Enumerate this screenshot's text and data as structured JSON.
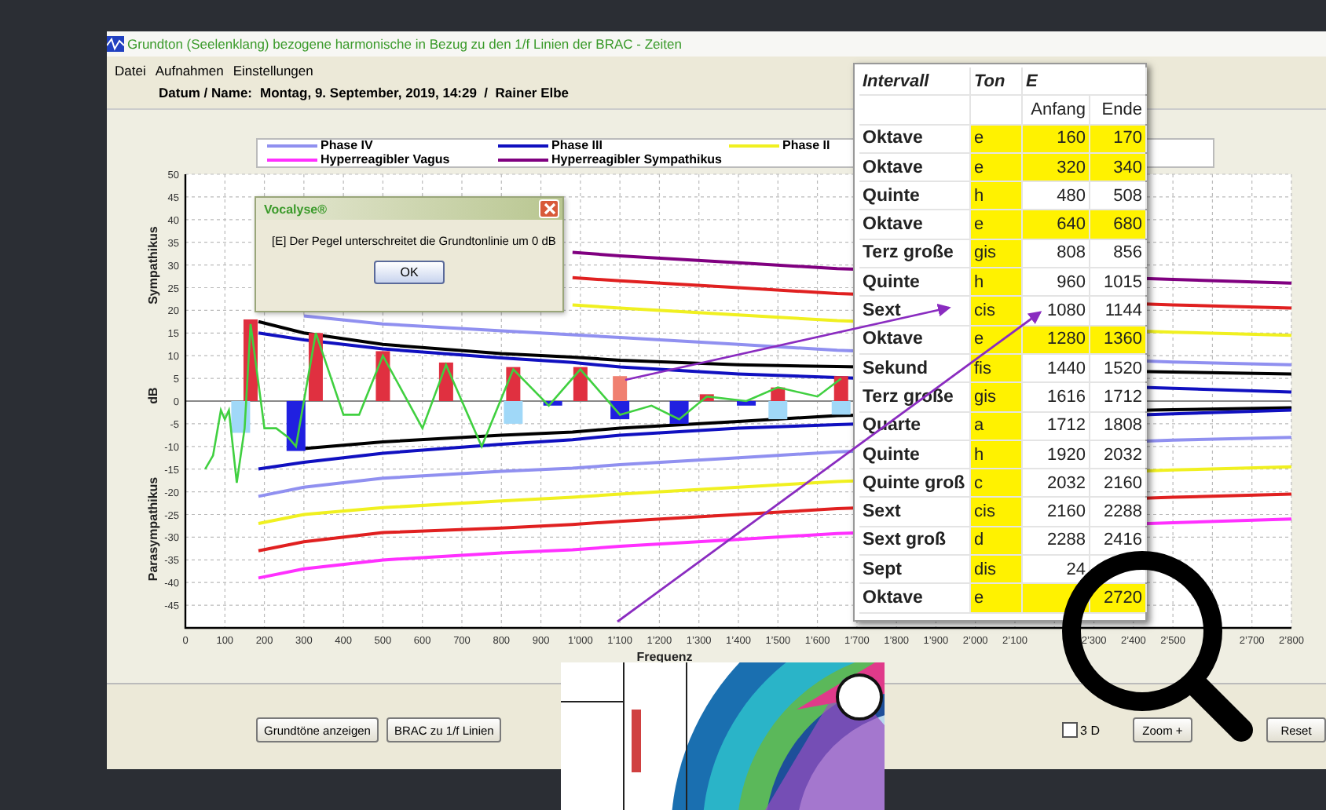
{
  "window": {
    "title": "Grundton (Seelenklang) bezogene harmonische in Bezug zu den 1/f Linien der BRAC - Zeiten"
  },
  "menu": [
    "Datei",
    "Aufnahmen",
    "Einstellungen"
  ],
  "header": {
    "label": "Datum / Name:",
    "value": "Montag, 9. September, 2019, 14:29  /  Rainer Elbe"
  },
  "chart": {
    "legend": [
      {
        "label": "Phase IV",
        "color": "#9090f0"
      },
      {
        "label": "Phase III",
        "color": "#1010c0"
      },
      {
        "label": "Phase II",
        "color": "#f0f020"
      },
      {
        "label": "Hyperreagibler Vagus",
        "color": "#ff30ff"
      },
      {
        "label": "Hyperreagibler Sympathikus",
        "color": "#800080"
      }
    ],
    "axis_labels": {
      "upper": "Sympathikus",
      "lower": "Parasympathikus"
    },
    "chart_data": {
      "type": "line",
      "xlabel": "Frequenz",
      "ylabel": "dB",
      "x": [
        185,
        300,
        500,
        800,
        980,
        1100,
        1400,
        1650,
        2500,
        2800
      ],
      "grid": true,
      "xlim": [
        0,
        2800
      ],
      "ylim": [
        -50,
        50
      ],
      "xticks": [
        {
          "value": 0,
          "label": "0"
        },
        {
          "value": 100,
          "label": "100"
        },
        {
          "value": 200,
          "label": "200"
        },
        {
          "value": 300,
          "label": "300"
        },
        {
          "value": 400,
          "label": "400"
        },
        {
          "value": 500,
          "label": "500"
        },
        {
          "value": 600,
          "label": "600"
        },
        {
          "value": 700,
          "label": "700"
        },
        {
          "value": 800,
          "label": "800"
        },
        {
          "value": 900,
          "label": "900"
        },
        {
          "value": 1000,
          "label": "1’000"
        },
        {
          "value": 1100,
          "label": "1’100"
        },
        {
          "value": 1200,
          "label": "1’200"
        },
        {
          "value": 1300,
          "label": "1’300"
        },
        {
          "value": 1400,
          "label": "1’400"
        },
        {
          "value": 1500,
          "label": "1’500"
        },
        {
          "value": 1600,
          "label": "1’600"
        },
        {
          "value": 1700,
          "label": "1’700"
        },
        {
          "value": 1800,
          "label": "1’800"
        },
        {
          "value": 1900,
          "label": "1’900"
        },
        {
          "value": 2000,
          "label": "2’000"
        },
        {
          "value": 2100,
          "label": "2’100"
        },
        {
          "value": 2300,
          "label": "2’300"
        },
        {
          "value": 2400,
          "label": "2’400"
        },
        {
          "value": 2500,
          "label": "2’500"
        },
        {
          "value": 2700,
          "label": "2’700"
        },
        {
          "value": 2800,
          "label": "2’800"
        }
      ],
      "yticks": [
        50,
        45,
        40,
        35,
        30,
        25,
        20,
        15,
        10,
        5,
        0,
        -5,
        -10,
        -15,
        -20,
        -25,
        -30,
        -35,
        -40,
        -45
      ],
      "series": [
        {
          "color": "#800080",
          "values": [
            null,
            null,
            null,
            null,
            32.8,
            32,
            30.5,
            29.2,
            26.8,
            26
          ]
        },
        {
          "color": "#e02020",
          "values": [
            null,
            null,
            null,
            null,
            27.2,
            26.5,
            25,
            23.7,
            21.2,
            20.5
          ]
        },
        {
          "color": "#f0f020",
          "values": [
            null,
            null,
            null,
            null,
            21.2,
            20.5,
            19,
            17.7,
            15.2,
            14.5
          ]
        },
        {
          "color": "#9090f0",
          "values": [
            null,
            18.8,
            17,
            15.5,
            14.6,
            14,
            12.5,
            11.2,
            8.6,
            8
          ]
        },
        {
          "color": "#000000",
          "values": [
            17.5,
            15,
            12.5,
            10.5,
            9.7,
            9,
            8,
            7.6,
            6.4,
            6
          ]
        },
        {
          "color": "#1010c0",
          "values": [
            15,
            13.5,
            11.5,
            9.5,
            8.5,
            7.5,
            6,
            5.2,
            2.8,
            2
          ]
        },
        {
          "color": "#000000",
          "values": [
            null,
            -10.5,
            -9,
            -7.5,
            -6.8,
            -6,
            -4.5,
            -3.2,
            -1.9,
            -1.5
          ]
        },
        {
          "color": "#1010c0",
          "values": [
            -15,
            -13.5,
            -11.5,
            -9.5,
            -8.5,
            -7.5,
            -6,
            -5.2,
            -2.8,
            -2
          ]
        },
        {
          "color": "#9090f0",
          "values": [
            -21,
            -19,
            -17,
            -15.5,
            -14.8,
            -14,
            -12.5,
            -11.2,
            -8.6,
            -8
          ]
        },
        {
          "color": "#f0f020",
          "values": [
            -27,
            -25,
            -23.5,
            -22,
            -21.2,
            -20.5,
            -19,
            -17.7,
            -15.2,
            -14.5
          ]
        },
        {
          "color": "#e02020",
          "values": [
            -33,
            -31,
            -29,
            -28,
            -27.2,
            -26.5,
            -25,
            -23.7,
            -21.2,
            -20.5
          ]
        },
        {
          "color": "#ff30ff",
          "values": [
            -39,
            -37,
            -35,
            -33.5,
            -32.8,
            -32,
            -30.5,
            -29.2,
            -26.8,
            -26
          ]
        },
        {
          "type": "bar",
          "color": "#e03040",
          "x": [
            165,
            330,
            500,
            660,
            830,
            1000,
            1320,
            1500,
            1660
          ],
          "values": [
            18,
            15,
            11,
            8.5,
            7.5,
            7.5,
            1.5,
            3,
            5.5
          ]
        },
        {
          "type": "bar",
          "color": "#f08070",
          "x": [
            1100
          ],
          "values": [
            5.5
          ]
        },
        {
          "type": "bar",
          "color": "#2020e0",
          "x": [
            280,
            930,
            1100,
            1250,
            1420
          ],
          "values": [
            -11,
            -1,
            -4,
            -5,
            -1
          ]
        },
        {
          "type": "bar",
          "color": "#a0d8f8",
          "x": [
            140,
            830,
            1500,
            1660
          ],
          "values": [
            -7,
            -5,
            -4,
            -3
          ]
        },
        {
          "color": "#40d040",
          "x": [
            50,
            70,
            90,
            100,
            110,
            130,
            150,
            165,
            200,
            230,
            260,
            280,
            330,
            400,
            440,
            500,
            600,
            660,
            750,
            830,
            920,
            1000,
            1100,
            1180,
            1250,
            1320,
            1420,
            1500,
            1600,
            1660
          ],
          "values": [
            -15,
            -12,
            -2,
            -4,
            -2,
            -18,
            -6,
            17,
            -6,
            -6,
            -8,
            -10,
            15,
            -3,
            -3,
            10,
            -6,
            8,
            -10,
            7,
            -1,
            7,
            -3,
            -1,
            -4,
            1,
            0,
            3,
            1,
            5
          ]
        }
      ]
    }
  },
  "dialog": {
    "title": "Vocalyse®",
    "message": "[E] Der Pegel unterschreitet die Grundtonlinie um 0 dB",
    "button": "OK"
  },
  "table": {
    "columns": [
      "Intervall",
      "Ton",
      "E"
    ],
    "subcolumns": [
      "Anfang",
      "Ende"
    ],
    "rows": [
      {
        "interval": "Oktave",
        "ton": "e",
        "anfang": "160",
        "ende": "170",
        "highlighted": true
      },
      {
        "interval": "Oktave",
        "ton": "e",
        "anfang": "320",
        "ende": "340",
        "highlighted": true
      },
      {
        "interval": "Quinte",
        "ton": "h",
        "anfang": "480",
        "ende": "508",
        "highlighted": false
      },
      {
        "interval": "Oktave",
        "ton": "e",
        "anfang": "640",
        "ende": "680",
        "highlighted": true
      },
      {
        "interval": "Terz große",
        "ton": "gis",
        "anfang": "808",
        "ende": "856",
        "highlighted": false
      },
      {
        "interval": "Quinte",
        "ton": "h",
        "anfang": "960",
        "ende": "1015",
        "highlighted": false
      },
      {
        "interval": "Sext",
        "ton": "cis",
        "anfang": "1080",
        "ende": "1144",
        "highlighted": false
      },
      {
        "interval": "Oktave",
        "ton": "e",
        "anfang": "1280",
        "ende": "1360",
        "highlighted": true
      },
      {
        "interval": "Sekund",
        "ton": "fis",
        "anfang": "1440",
        "ende": "1520",
        "highlighted": false
      },
      {
        "interval": "Terz große",
        "ton": "gis",
        "anfang": "1616",
        "ende": "1712",
        "highlighted": false
      },
      {
        "interval": "Quarte",
        "ton": "a",
        "anfang": "1712",
        "ende": "1808",
        "highlighted": false
      },
      {
        "interval": "Quinte",
        "ton": "h",
        "anfang": "1920",
        "ende": "2032",
        "highlighted": false
      },
      {
        "interval": "Quinte groß",
        "ton": "c",
        "anfang": "2032",
        "ende": "2160",
        "highlighted": false
      },
      {
        "interval": "Sext",
        "ton": "cis",
        "anfang": "2160",
        "ende": "2288",
        "highlighted": false
      },
      {
        "interval": "Sext groß",
        "ton": "d",
        "anfang": "2288",
        "ende": "2416",
        "highlighted": false
      },
      {
        "interval": "Sept",
        "ton": "dis",
        "anfang": "24",
        "highlighted": false
      },
      {
        "interval": "Oktave",
        "ton": "e",
        "ende": "2720",
        "highlighted": true
      }
    ]
  },
  "buttons": [
    {
      "label": "Grundtöne anzeigen"
    },
    {
      "label": "BRAC zu 1/f Linien"
    }
  ],
  "checkbox": {
    "label": "3 D",
    "checked": false
  },
  "right_buttons": [
    {
      "label": "Zoom +"
    },
    {
      "label": "Reset"
    }
  ],
  "inset": {
    "kind": "picture"
  }
}
